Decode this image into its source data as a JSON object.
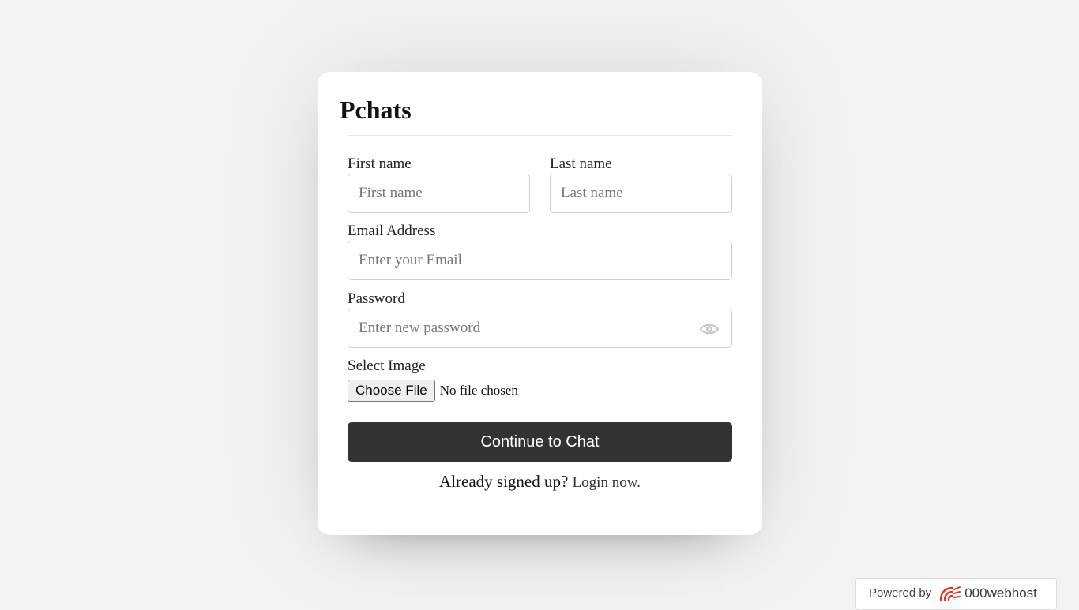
{
  "app": {
    "title": "Pchats"
  },
  "form": {
    "first_name": {
      "label": "First name",
      "placeholder": "First name",
      "value": ""
    },
    "last_name": {
      "label": "Last name",
      "placeholder": "Last name",
      "value": ""
    },
    "email": {
      "label": "Email Address",
      "placeholder": "Enter your Email",
      "value": ""
    },
    "password": {
      "label": "Password",
      "placeholder": "Enter new password",
      "value": "",
      "toggle_icon": "eye-icon"
    },
    "image": {
      "label": "Select Image",
      "button_label": "Choose File",
      "status": "No file chosen"
    },
    "submit_label": "Continue to Chat",
    "footer": {
      "prompt": "Already signed up?",
      "link_label": "Login now."
    }
  },
  "badge": {
    "prefix": "Powered by",
    "brand": "000webhost",
    "logo_icon": "000webhost-logo-icon",
    "brand_color": "#e0331f"
  },
  "colors": {
    "background": "#f3f3f3",
    "card": "#ffffff",
    "button": "#333333",
    "button_text": "#ffffff"
  }
}
